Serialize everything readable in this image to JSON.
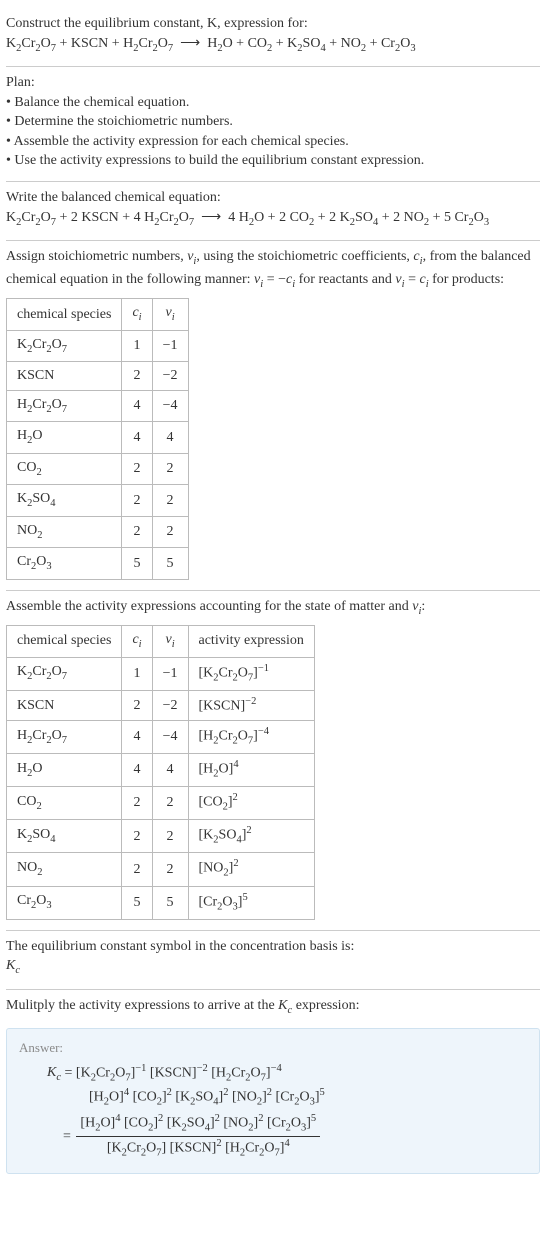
{
  "intro": {
    "line1": "Construct the equilibrium constant, K, expression for:",
    "equation_html": "K<sub>2</sub>Cr<sub>2</sub>O<sub>7</sub> + KSCN + H<sub>2</sub>Cr<sub>2</sub>O<sub>7</sub> &nbsp;⟶&nbsp; H<sub>2</sub>O + CO<sub>2</sub> + K<sub>2</sub>SO<sub>4</sub> + NO<sub>2</sub> + Cr<sub>2</sub>O<sub>3</sub>"
  },
  "plan": {
    "heading": "Plan:",
    "items": [
      "Balance the chemical equation.",
      "Determine the stoichiometric numbers.",
      "Assemble the activity expression for each chemical species.",
      "Use the activity expressions to build the equilibrium constant expression."
    ]
  },
  "balanced": {
    "heading": "Write the balanced chemical equation:",
    "equation_html": "K<sub>2</sub>Cr<sub>2</sub>O<sub>7</sub> + 2 KSCN + 4 H<sub>2</sub>Cr<sub>2</sub>O<sub>7</sub> &nbsp;⟶&nbsp; 4 H<sub>2</sub>O + 2 CO<sub>2</sub> + 2 K<sub>2</sub>SO<sub>4</sub> + 2 NO<sub>2</sub> + 5 Cr<sub>2</sub>O<sub>3</sub>"
  },
  "assign": {
    "text_html": "Assign stoichiometric numbers, <i>ν<sub>i</sub></i>, using the stoichiometric coefficients, <i>c<sub>i</sub></i>, from the balanced chemical equation in the following manner: <i>ν<sub>i</sub></i> = −<i>c<sub>i</sub></i> for reactants and <i>ν<sub>i</sub></i> = <i>c<sub>i</sub></i> for products:"
  },
  "table1": {
    "headers": [
      "chemical species",
      "c_i",
      "ν_i"
    ],
    "headers_html": [
      "chemical species",
      "<i>c<sub>i</sub></i>",
      "<i>ν<sub>i</sub></i>"
    ],
    "rows": [
      {
        "species_html": "K<sub>2</sub>Cr<sub>2</sub>O<sub>7</sub>",
        "c": "1",
        "v": "−1"
      },
      {
        "species_html": "KSCN",
        "c": "2",
        "v": "−2"
      },
      {
        "species_html": "H<sub>2</sub>Cr<sub>2</sub>O<sub>7</sub>",
        "c": "4",
        "v": "−4"
      },
      {
        "species_html": "H<sub>2</sub>O",
        "c": "4",
        "v": "4"
      },
      {
        "species_html": "CO<sub>2</sub>",
        "c": "2",
        "v": "2"
      },
      {
        "species_html": "K<sub>2</sub>SO<sub>4</sub>",
        "c": "2",
        "v": "2"
      },
      {
        "species_html": "NO<sub>2</sub>",
        "c": "2",
        "v": "2"
      },
      {
        "species_html": "Cr<sub>2</sub>O<sub>3</sub>",
        "c": "5",
        "v": "5"
      }
    ]
  },
  "assemble": {
    "text_html": "Assemble the activity expressions accounting for the state of matter and <i>ν<sub>i</sub></i>:"
  },
  "table2": {
    "headers_html": [
      "chemical species",
      "<i>c<sub>i</sub></i>",
      "<i>ν<sub>i</sub></i>",
      "activity expression"
    ],
    "rows": [
      {
        "species_html": "K<sub>2</sub>Cr<sub>2</sub>O<sub>7</sub>",
        "c": "1",
        "v": "−1",
        "act_html": "[K<sub>2</sub>Cr<sub>2</sub>O<sub>7</sub>]<sup>−1</sup>"
      },
      {
        "species_html": "KSCN",
        "c": "2",
        "v": "−2",
        "act_html": "[KSCN]<sup>−2</sup>"
      },
      {
        "species_html": "H<sub>2</sub>Cr<sub>2</sub>O<sub>7</sub>",
        "c": "4",
        "v": "−4",
        "act_html": "[H<sub>2</sub>Cr<sub>2</sub>O<sub>7</sub>]<sup>−4</sup>"
      },
      {
        "species_html": "H<sub>2</sub>O",
        "c": "4",
        "v": "4",
        "act_html": "[H<sub>2</sub>O]<sup>4</sup>"
      },
      {
        "species_html": "CO<sub>2</sub>",
        "c": "2",
        "v": "2",
        "act_html": "[CO<sub>2</sub>]<sup>2</sup>"
      },
      {
        "species_html": "K<sub>2</sub>SO<sub>4</sub>",
        "c": "2",
        "v": "2",
        "act_html": "[K<sub>2</sub>SO<sub>4</sub>]<sup>2</sup>"
      },
      {
        "species_html": "NO<sub>2</sub>",
        "c": "2",
        "v": "2",
        "act_html": "[NO<sub>2</sub>]<sup>2</sup>"
      },
      {
        "species_html": "Cr<sub>2</sub>O<sub>3</sub>",
        "c": "5",
        "v": "5",
        "act_html": "[Cr<sub>2</sub>O<sub>3</sub>]<sup>5</sup>"
      }
    ]
  },
  "symbol": {
    "line1": "The equilibrium constant symbol in the concentration basis is:",
    "kc_html": "<i>K<sub>c</sub></i>"
  },
  "multiply": {
    "text_html": "Mulitply the activity expressions to arrive at the <i>K<sub>c</sub></i> expression:"
  },
  "answer": {
    "label": "Answer:",
    "line1_html": "<i>K<sub>c</sub></i> = [K<sub>2</sub>Cr<sub>2</sub>O<sub>7</sub>]<sup>−1</sup> [KSCN]<sup>−2</sup> [H<sub>2</sub>Cr<sub>2</sub>O<sub>7</sub>]<sup>−4</sup>",
    "line2_html": "[H<sub>2</sub>O]<sup>4</sup> [CO<sub>2</sub>]<sup>2</sup> [K<sub>2</sub>SO<sub>4</sub>]<sup>2</sup> [NO<sub>2</sub>]<sup>2</sup> [Cr<sub>2</sub>O<sub>3</sub>]<sup>5</sup>",
    "frac_num_html": "[H<sub>2</sub>O]<sup>4</sup> [CO<sub>2</sub>]<sup>2</sup> [K<sub>2</sub>SO<sub>4</sub>]<sup>2</sup> [NO<sub>2</sub>]<sup>2</sup> [Cr<sub>2</sub>O<sub>3</sub>]<sup>5</sup>",
    "frac_den_html": "[K<sub>2</sub>Cr<sub>2</sub>O<sub>7</sub>] [KSCN]<sup>2</sup> [H<sub>2</sub>Cr<sub>2</sub>O<sub>7</sub>]<sup>4</sup>"
  }
}
